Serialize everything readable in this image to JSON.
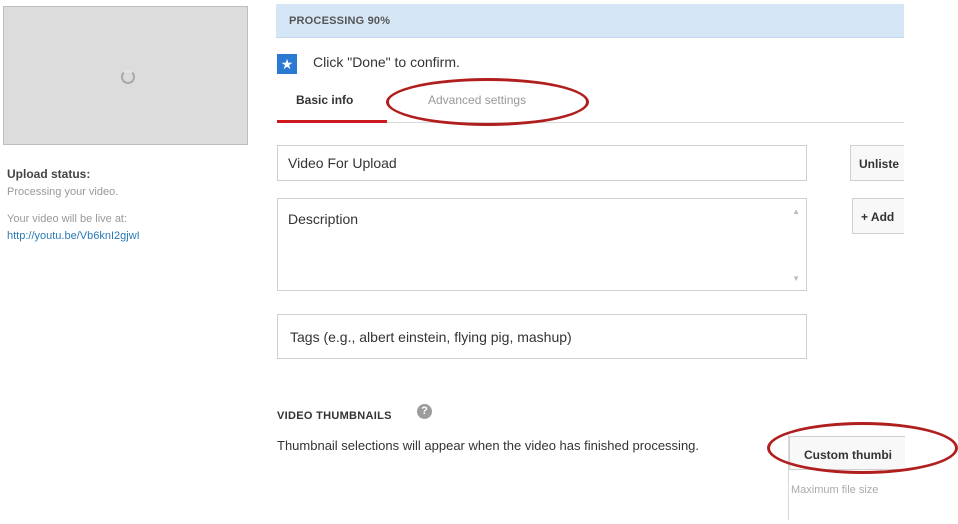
{
  "upload": {
    "status_title": "Upload status:",
    "status_text": "Processing your video.",
    "live_text": "Your video will be live at:",
    "live_url": "http://youtu.be/Vb6knI2gjwI"
  },
  "processing": {
    "label": "PROCESSING 90%",
    "progress": 0.9,
    "confirm_text": "Click \"Done\" to confirm."
  },
  "tabs": [
    {
      "label": "Basic info",
      "active": true
    },
    {
      "label": "Advanced settings",
      "active": false
    }
  ],
  "form": {
    "title_value": "Video For Upload",
    "description_placeholder": "Description",
    "tags_placeholder": "Tags (e.g., albert einstein, flying pig, mashup)"
  },
  "side": {
    "privacy_label": "Unliste",
    "add_label": "+ Add"
  },
  "thumbnails": {
    "heading": "VIDEO THUMBNAILS",
    "note": "Thumbnail selections will appear when the video has finished processing.",
    "custom_button": "Custom thumbi",
    "max_size_text": "Maximum file size"
  },
  "colors": {
    "accent_blue": "#2a7ad4",
    "progress_bg": "#d5e7f6",
    "tab_underline": "#cc181e",
    "annotation_ellipse": "#b01e1e"
  },
  "icons": {
    "star": "star-icon",
    "help": "help-icon",
    "spinner": "loading-spinner-icon"
  }
}
